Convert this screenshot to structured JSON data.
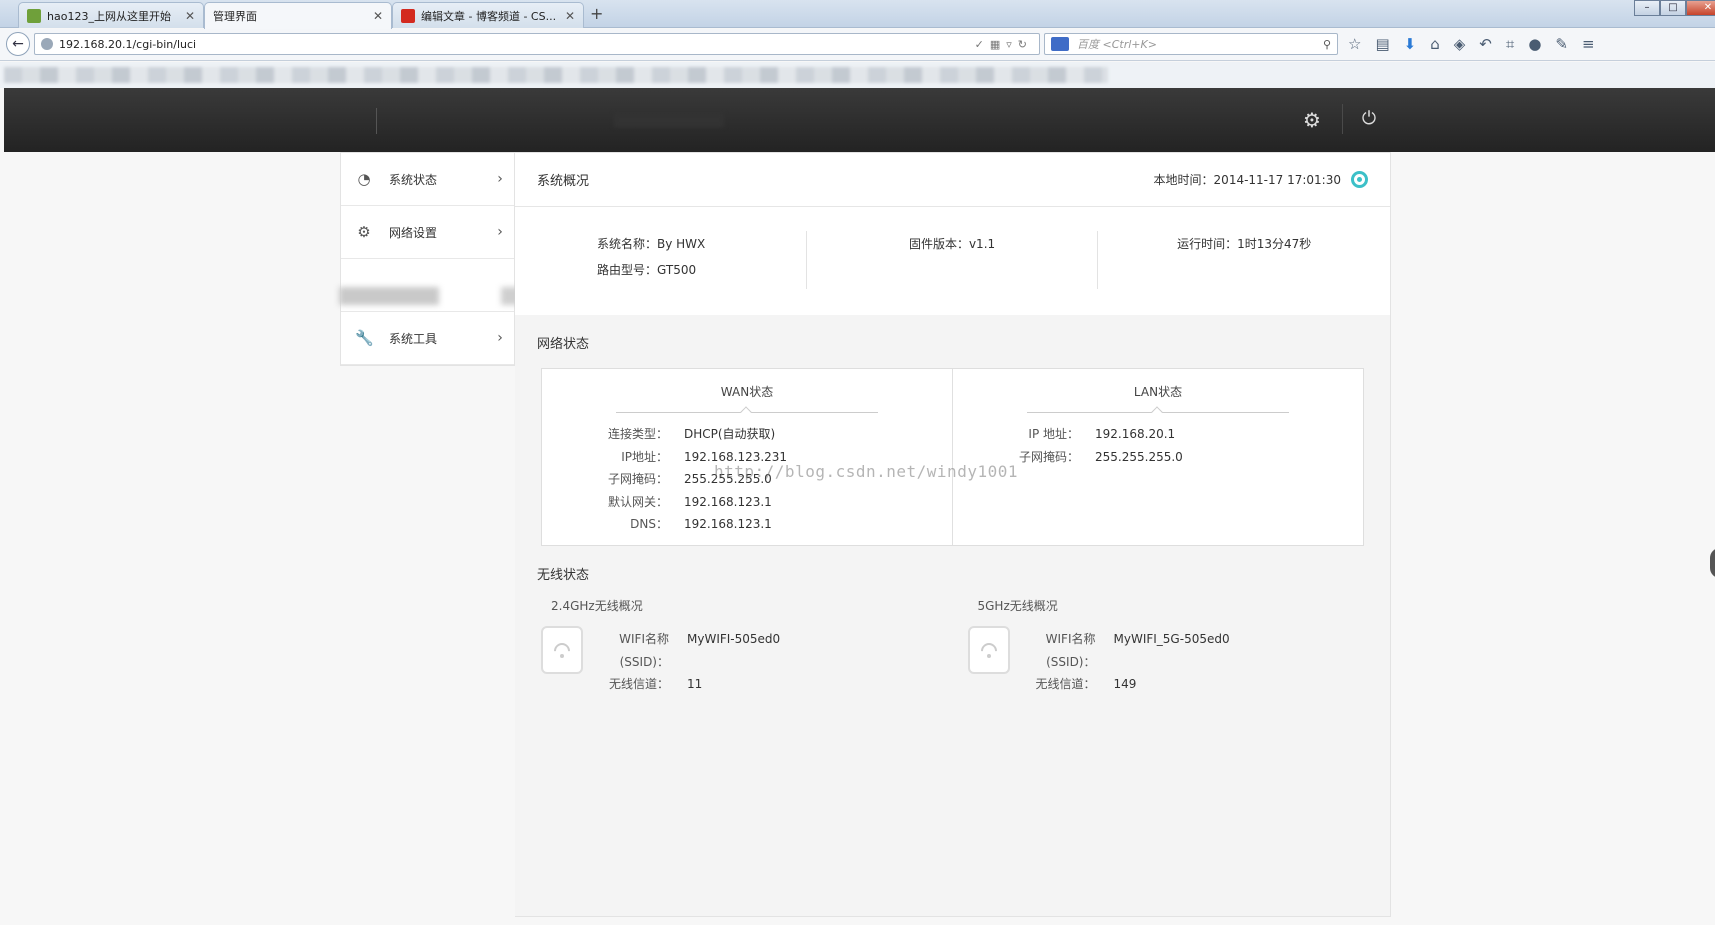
{
  "browser": {
    "tabs": [
      {
        "title": "hao123_上网从这里开始",
        "favicon_color": "#6fa03a"
      },
      {
        "title": "管理界面",
        "favicon_color": "#cccccc"
      },
      {
        "title": "编辑文章 - 博客频道 - CS...",
        "favicon_color": "#d32a1f"
      }
    ],
    "new_tab": "+",
    "url": "192.168.20.1/cgi-bin/luci",
    "search_placeholder": "百度 <Ctrl+K>",
    "window_controls": {
      "minimize": "–",
      "maximize": "□",
      "close": "✕"
    }
  },
  "side_menu": {
    "items": [
      {
        "label": "系统状态",
        "icon": "gauge-icon"
      },
      {
        "label": "网络设置",
        "icon": "gear-icon"
      },
      {
        "label": "",
        "icon": ""
      },
      {
        "label": "系统工具",
        "icon": "wrench-icon"
      }
    ]
  },
  "overview": {
    "title": "系统概况",
    "local_time": "本地时间：2014-11-17 17:01:30",
    "system_name": "系统名称：By HWX",
    "router_model": "路由型号：GT500",
    "firmware": "固件版本：v1.1",
    "uptime": "运行时间：1时13分47秒"
  },
  "network": {
    "title": "网络状态",
    "wan": {
      "title": "WAN状态",
      "rows": [
        {
          "k": "连接类型：",
          "v": "DHCP(自动获取)"
        },
        {
          "k": "IP地址：",
          "v": "192.168.123.231"
        },
        {
          "k": "子网掩码：",
          "v": "255.255.255.0"
        },
        {
          "k": "默认网关：",
          "v": "192.168.123.1"
        },
        {
          "k": "DNS：",
          "v": "192.168.123.1"
        }
      ]
    },
    "lan": {
      "title": "LAN状态",
      "rows": [
        {
          "k": "IP 地址：",
          "v": "192.168.20.1"
        },
        {
          "k": "子网掩码：",
          "v": "255.255.255.0"
        }
      ]
    }
  },
  "wireless": {
    "title": "无线状态",
    "band24": {
      "title": "2.4GHz无线概况",
      "rows": [
        {
          "k": "WIFI名称(SSID)：",
          "v": "MyWIFI-505ed0"
        },
        {
          "k": "无线信道：",
          "v": "11"
        }
      ]
    },
    "band5": {
      "title": "5GHz无线概况",
      "rows": [
        {
          "k": "WIFI名称(SSID)：",
          "v": "MyWIFI_5G-505ed0"
        },
        {
          "k": "无线信道：",
          "v": "149"
        }
      ]
    }
  },
  "watermark": "http://blog.csdn.net/windy1001"
}
